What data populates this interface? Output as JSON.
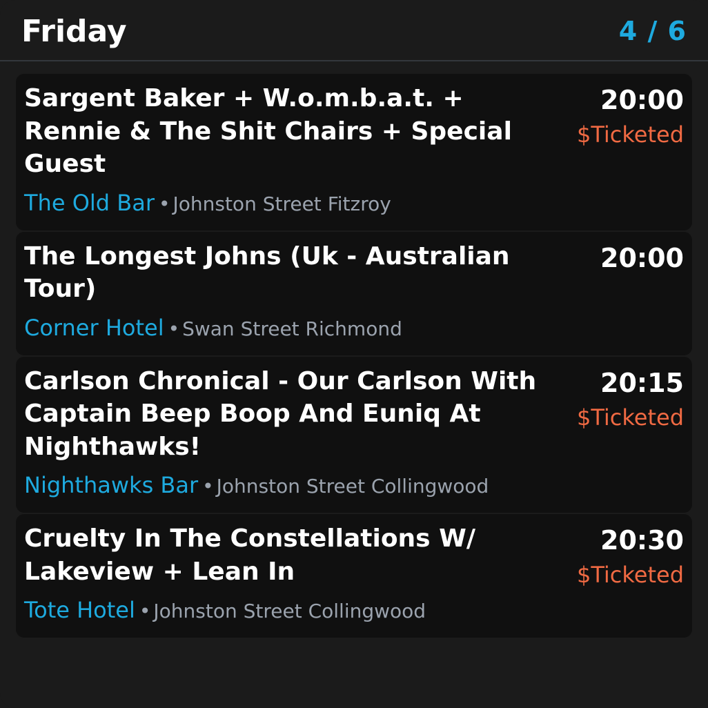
{
  "header": {
    "day": "Friday",
    "page_indicator": "4 / 6"
  },
  "colors": {
    "background": "#1b1b1b",
    "card": "#101010",
    "accent": "#1eaadf",
    "price": "#f06a43",
    "muted": "#9ba3ae"
  },
  "events": [
    {
      "title": "Sargent Baker + W.o.m.b.a.t. + Rennie & The Shit Chairs + Special Guest",
      "time": "20:00",
      "price": "$Ticketed",
      "venue": "The Old Bar",
      "separator": "•",
      "address": "Johnston Street Fitzroy"
    },
    {
      "title": "The Longest Johns (Uk - Australian Tour)",
      "time": "20:00",
      "price": "",
      "venue": "Corner Hotel",
      "separator": "•",
      "address": "Swan Street Richmond"
    },
    {
      "title": "Carlson Chronical - Our Carlson With Captain Beep Boop And Euniq At Nighthawks!",
      "time": "20:15",
      "price": "$Ticketed",
      "venue": "Nighthawks Bar",
      "separator": "•",
      "address": "Johnston Street Collingwood"
    },
    {
      "title": "Cruelty In The Constellations W/ Lakeview + Lean In",
      "time": "20:30",
      "price": "$Ticketed",
      "venue": "Tote Hotel",
      "separator": "•",
      "address": "Johnston Street Collingwood"
    }
  ]
}
